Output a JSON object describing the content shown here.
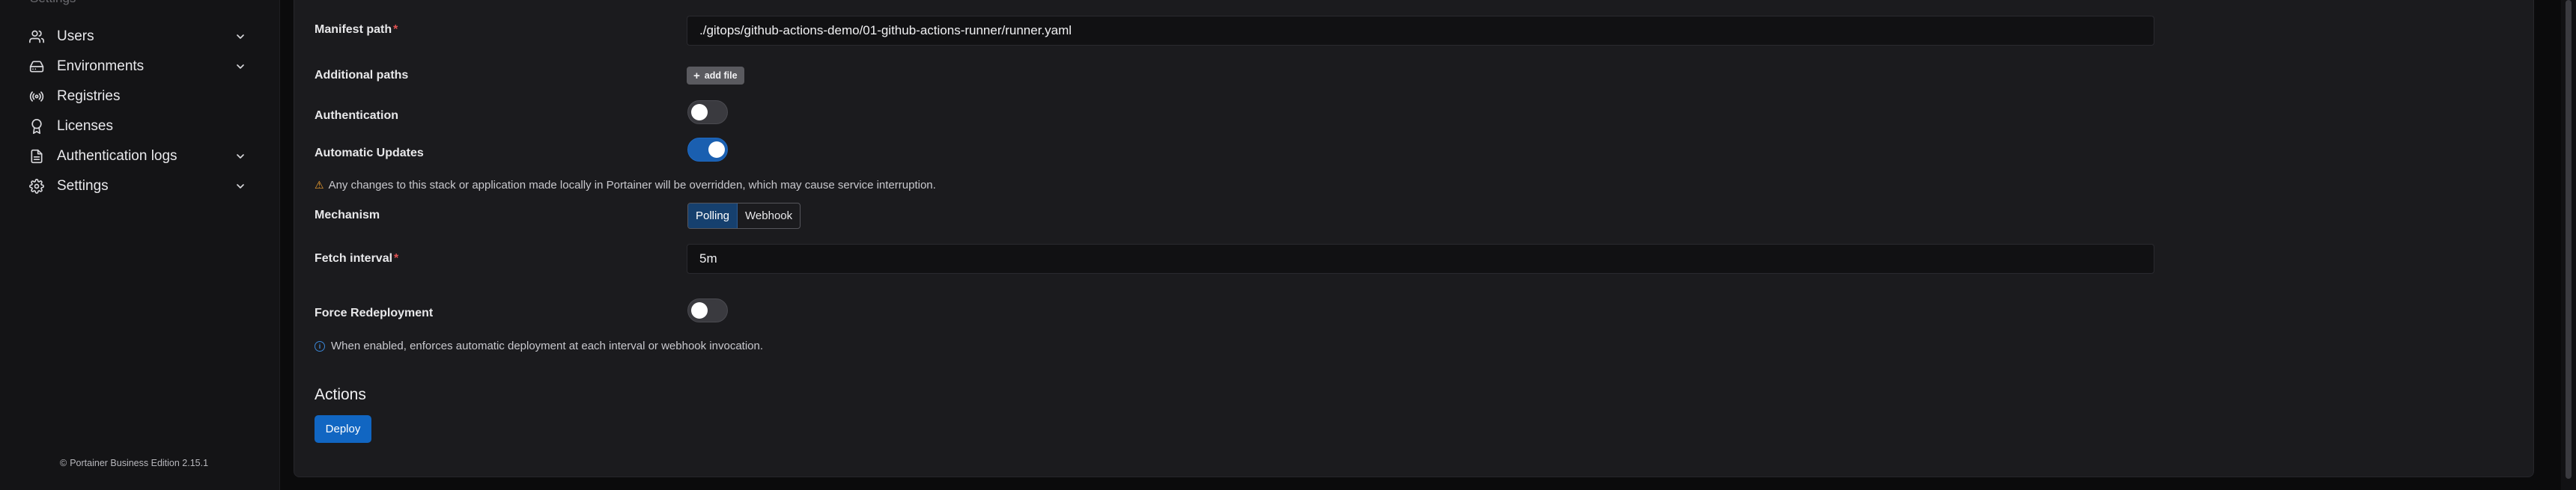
{
  "sidebar": {
    "heading": "Settings",
    "items": [
      {
        "label": "Users",
        "icon": "users-icon",
        "has_chevron": true
      },
      {
        "label": "Environments",
        "icon": "hard-drive-icon",
        "has_chevron": true
      },
      {
        "label": "Registries",
        "icon": "radio-icon",
        "has_chevron": false
      },
      {
        "label": "Licenses",
        "icon": "award-icon",
        "has_chevron": false
      },
      {
        "label": "Authentication logs",
        "icon": "file-text-icon",
        "has_chevron": true
      },
      {
        "label": "Settings",
        "icon": "gear-icon",
        "has_chevron": true
      }
    ],
    "footer": {
      "copyright_symbol": "©",
      "text": "Portainer Business Edition 2.15.1"
    }
  },
  "form": {
    "manifest_path": {
      "label": "Manifest path",
      "required": "*",
      "value": "./gitops/github-actions-demo/01-github-actions-runner/runner.yaml"
    },
    "additional_paths": {
      "label": "Additional paths",
      "button_label": "add file"
    },
    "authentication": {
      "label": "Authentication",
      "enabled": false
    },
    "automatic_updates": {
      "label": "Automatic Updates",
      "enabled": true
    },
    "warning": {
      "icon": "warning-triangle-icon",
      "text": "Any changes to this stack or application made locally in Portainer will be overridden, which may cause service interruption."
    },
    "mechanism": {
      "label": "Mechanism",
      "options": [
        "Polling",
        "Webhook"
      ],
      "selected": "Polling"
    },
    "fetch_interval": {
      "label": "Fetch interval",
      "required": "*",
      "value": "5m"
    },
    "force_redeployment": {
      "label": "Force Redeployment",
      "enabled": false
    },
    "info": {
      "icon": "info-circle-icon",
      "text": "When enabled, enforces automatic deployment at each interval or webhook invocation."
    }
  },
  "actions": {
    "title": "Actions",
    "deploy_label": "Deploy"
  },
  "colors": {
    "accent": "#1166c2",
    "toggle_on": "#1a5fb0",
    "warning": "#f0a030",
    "required": "#e05252"
  }
}
